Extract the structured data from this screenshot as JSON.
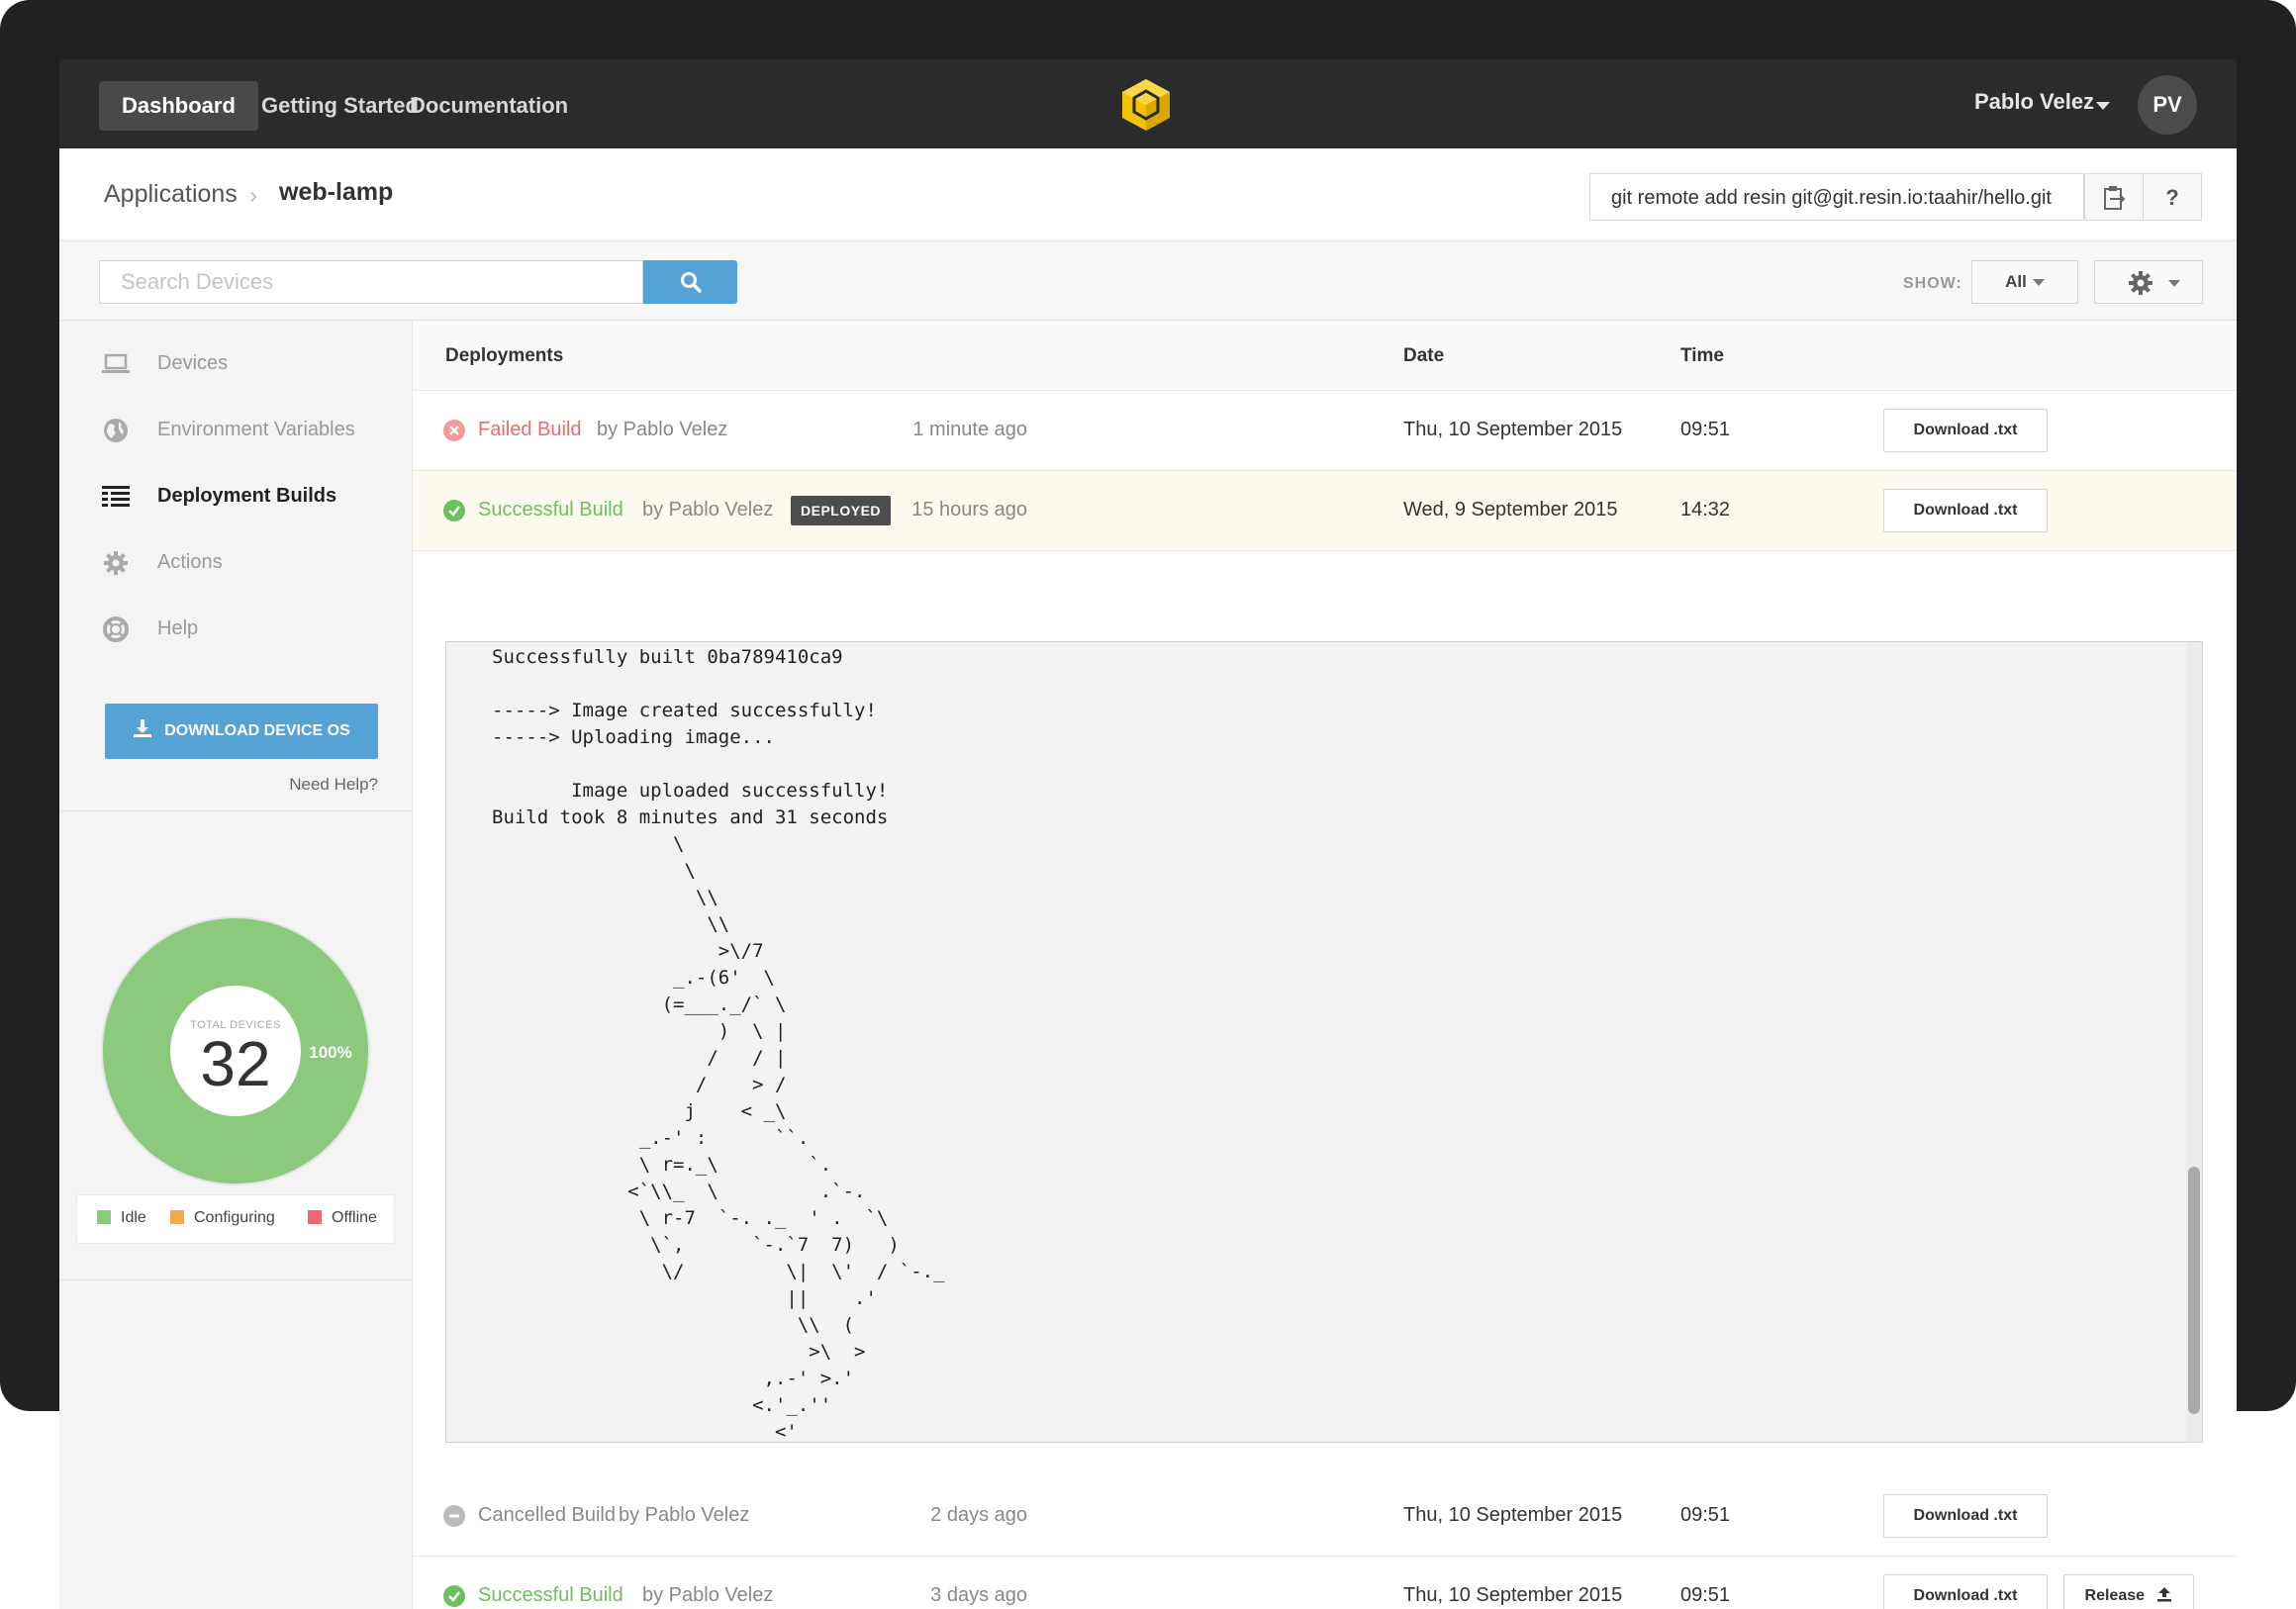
{
  "nav": {
    "items": [
      "Dashboard",
      "Getting Started",
      "Documentation"
    ],
    "user_name": "Pablo Velez",
    "avatar_initials": "PV",
    "logo_color": "#f3c200"
  },
  "breadcrumb": {
    "root": "Applications",
    "current": "web-lamp"
  },
  "git": {
    "command": "git remote add resin git@git.resin.io:taahir/hello.git",
    "help_label": "?"
  },
  "search": {
    "placeholder": "Search Devices",
    "value": ""
  },
  "filter": {
    "show_label": "SHOW:",
    "show_value": "All"
  },
  "sidebar": {
    "items": [
      {
        "label": "Devices",
        "icon": "laptop-icon",
        "active": false
      },
      {
        "label": "Environment Variables",
        "icon": "globe-icon",
        "active": false
      },
      {
        "label": "Deployment Builds",
        "icon": "builds-icon",
        "active": true
      },
      {
        "label": "Actions",
        "icon": "gear-icon",
        "active": false
      },
      {
        "label": "Help",
        "icon": "lifebuoy-icon",
        "active": false
      }
    ],
    "download_label": "DOWNLOAD DEVICE OS",
    "need_help": "Need Help?"
  },
  "device_summary": {
    "caption": "TOTAL DEVICES",
    "total": "32",
    "percent_label": "100%",
    "idle_fraction": 1.0,
    "legend": [
      {
        "label": "Idle",
        "color": "#8bc97d"
      },
      {
        "label": "Configuring",
        "color": "#f5a94c"
      },
      {
        "label": "Offline",
        "color": "#ee6a6a"
      }
    ]
  },
  "table": {
    "headers": {
      "deployments": "Deployments",
      "date": "Date",
      "time": "Time"
    },
    "rows": [
      {
        "status": "Failed Build",
        "by": "by Pablo Velez",
        "ago": "1 minute ago",
        "date": "Thu, 10 September 2015",
        "time": "09:51",
        "download": "Download .txt"
      },
      {
        "status": "Successful Build",
        "by": "by Pablo Velez",
        "badge": "DEPLOYED",
        "ago": "15 hours ago",
        "date": "Wed, 9 September 2015",
        "time": "14:32",
        "download": "Download .txt"
      },
      {
        "status": "Cancelled Build",
        "by": "by Pablo Velez",
        "ago": "2 days ago",
        "date": "Thu, 10 September 2015",
        "time": "09:51",
        "download": "Download .txt"
      },
      {
        "status": "Successful Build",
        "by": "by Pablo Velez",
        "ago": "3 days ago",
        "date": "Thu, 10 September 2015",
        "time": "09:51",
        "download": "Download .txt",
        "release": "Release"
      }
    ]
  },
  "status_colors": {
    "failed": "#ee6a6a",
    "success": "#6cbf5c",
    "cancelled": "#999999"
  },
  "build_log": "Successfully built 0ba789410ca9\n\n-----> Image created successfully!\n-----> Uploading image...\n\n       Image uploaded successfully!\nBuild took 8 minutes and 31 seconds\n                \\\n                 \\\n                  \\\\\n                   \\\\\n                    >\\/7\n                _.-(6'  \\\n               (=___._/` \\\n                    )  \\ |\n                   /   / |\n                  /    > /\n                 j    < _\\\n             _.-' :      ``.\n             \\ r=._\\        `.\n            <`\\\\_  \\         .`-.\n             \\ r-7  `-. ._  ' .  `\\\n              \\`,      `-.`7  7)   )\n               \\/         \\|  \\'  / `-._\n                          ||    .'\n                           \\\\  (\n                            >\\  >\n                        ,.-' >.'\n                       <.'_.''\n                         <'"
}
